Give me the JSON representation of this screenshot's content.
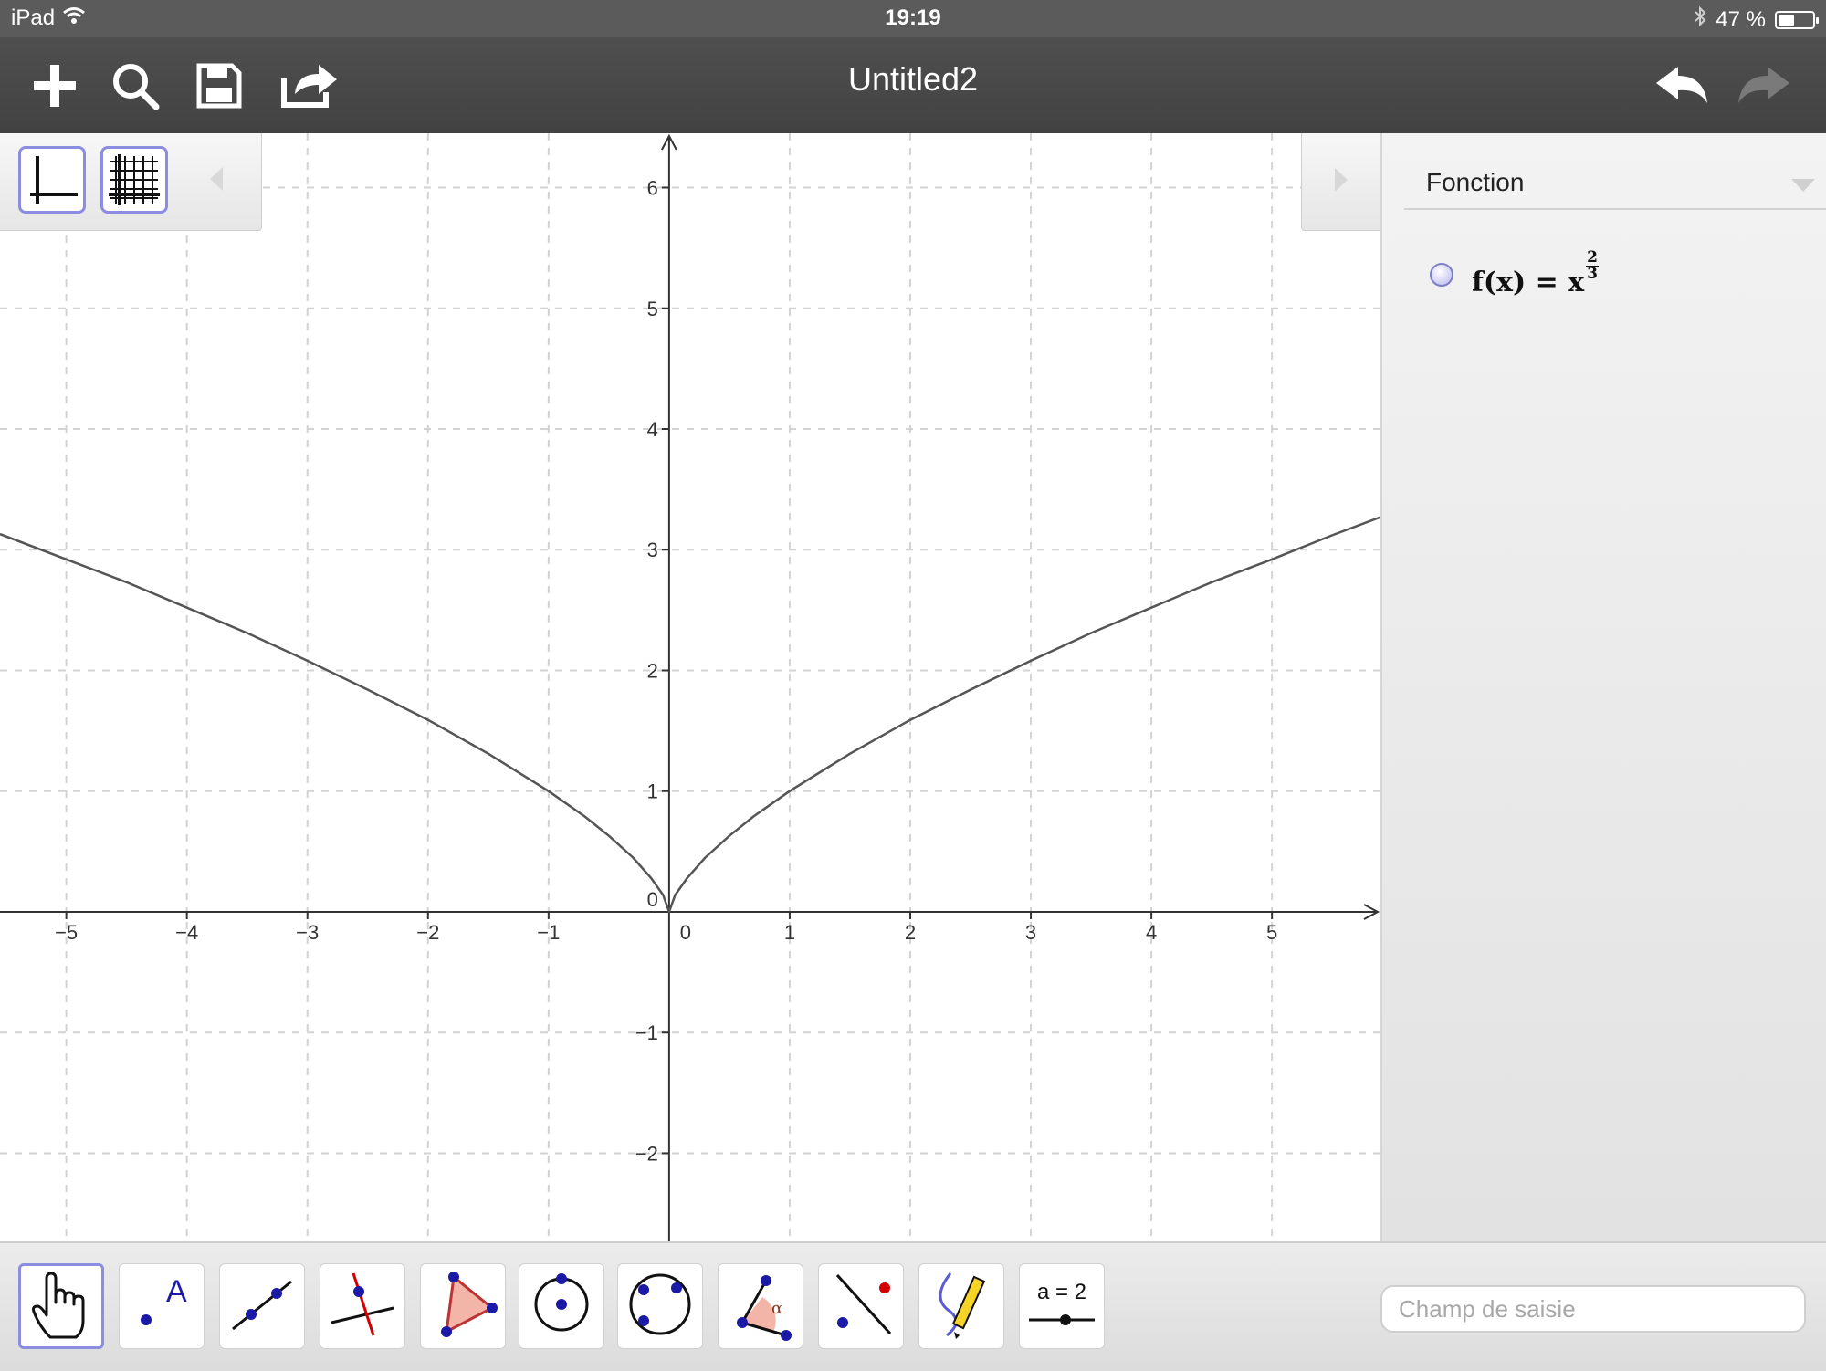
{
  "status_bar": {
    "device": "iPad",
    "time": "19:19",
    "battery": "47 %",
    "battery_level": 0.47
  },
  "toolbar": {
    "title": "Untitled2",
    "icons": [
      "plus-icon",
      "search-icon",
      "save-icon",
      "share-icon",
      "undo-icon",
      "redo-icon"
    ]
  },
  "style_bar": {
    "icons": [
      "axes-icon",
      "grid-icon",
      "collapse-left-icon"
    ]
  },
  "algebra": {
    "header": "Fonction",
    "entries": [
      {
        "prefix": "f(x) = x",
        "exp_num": "2",
        "exp_den": "3",
        "color": "#b6b6f0"
      }
    ]
  },
  "input_bar": {
    "placeholder": "Champ de saisie"
  },
  "tools": [
    {
      "name": "move-tool",
      "icon": "hand-icon",
      "active": true
    },
    {
      "name": "point-tool",
      "icon": "point-icon",
      "label": "A"
    },
    {
      "name": "line-tool",
      "icon": "line-icon"
    },
    {
      "name": "perpendicular-tool",
      "icon": "perpendicular-icon"
    },
    {
      "name": "polygon-tool",
      "icon": "polygon-icon"
    },
    {
      "name": "circle-center-tool",
      "icon": "circle-center-icon"
    },
    {
      "name": "circle-three-points-tool",
      "icon": "circle-three-points-icon"
    },
    {
      "name": "angle-tool",
      "icon": "angle-icon",
      "label": "α"
    },
    {
      "name": "reflect-tool",
      "icon": "reflect-icon"
    },
    {
      "name": "freehand-tool",
      "icon": "pen-icon"
    },
    {
      "name": "slider-tool",
      "icon": "slider-icon",
      "label": "a = 2"
    }
  ],
  "chart_data": {
    "type": "line",
    "function": "x^(2/3)",
    "xlim": [
      -5.55,
      5.9
    ],
    "ylim": [
      -2.73,
      6.45
    ],
    "x_ticks": [
      "−5",
      "−4",
      "−3",
      "−2",
      "−1",
      "0",
      "1",
      "2",
      "3",
      "4",
      "5"
    ],
    "x_tick_values": [
      -5,
      -4,
      -3,
      -2,
      -1,
      0,
      1,
      2,
      3,
      4,
      5
    ],
    "y_ticks": [
      "−2",
      "−1",
      "0",
      "1",
      "2",
      "3",
      "4",
      "5",
      "6"
    ],
    "y_tick_values": [
      -2,
      -1,
      0,
      1,
      2,
      3,
      4,
      5,
      6
    ],
    "grid": true,
    "line_color": "#555555",
    "series": [
      {
        "x": [
          -5.55,
          -5,
          -4.5,
          -4,
          -3.5,
          -3,
          -2.5,
          -2,
          -1.5,
          -1,
          -0.7,
          -0.5,
          -0.3,
          -0.15,
          -0.05,
          0,
          0.05,
          0.15,
          0.3,
          0.5,
          0.7,
          1,
          1.5,
          2,
          2.5,
          3,
          3.5,
          4,
          4.5,
          5,
          5.5,
          5.9
        ],
        "y": [
          3.13,
          2.92,
          2.73,
          2.52,
          2.31,
          2.08,
          1.84,
          1.59,
          1.31,
          1.0,
          0.79,
          0.63,
          0.45,
          0.28,
          0.14,
          0,
          0.14,
          0.28,
          0.45,
          0.63,
          0.79,
          1.0,
          1.31,
          1.59,
          1.84,
          2.08,
          2.31,
          2.52,
          2.73,
          2.92,
          3.12,
          3.27
        ]
      }
    ]
  }
}
